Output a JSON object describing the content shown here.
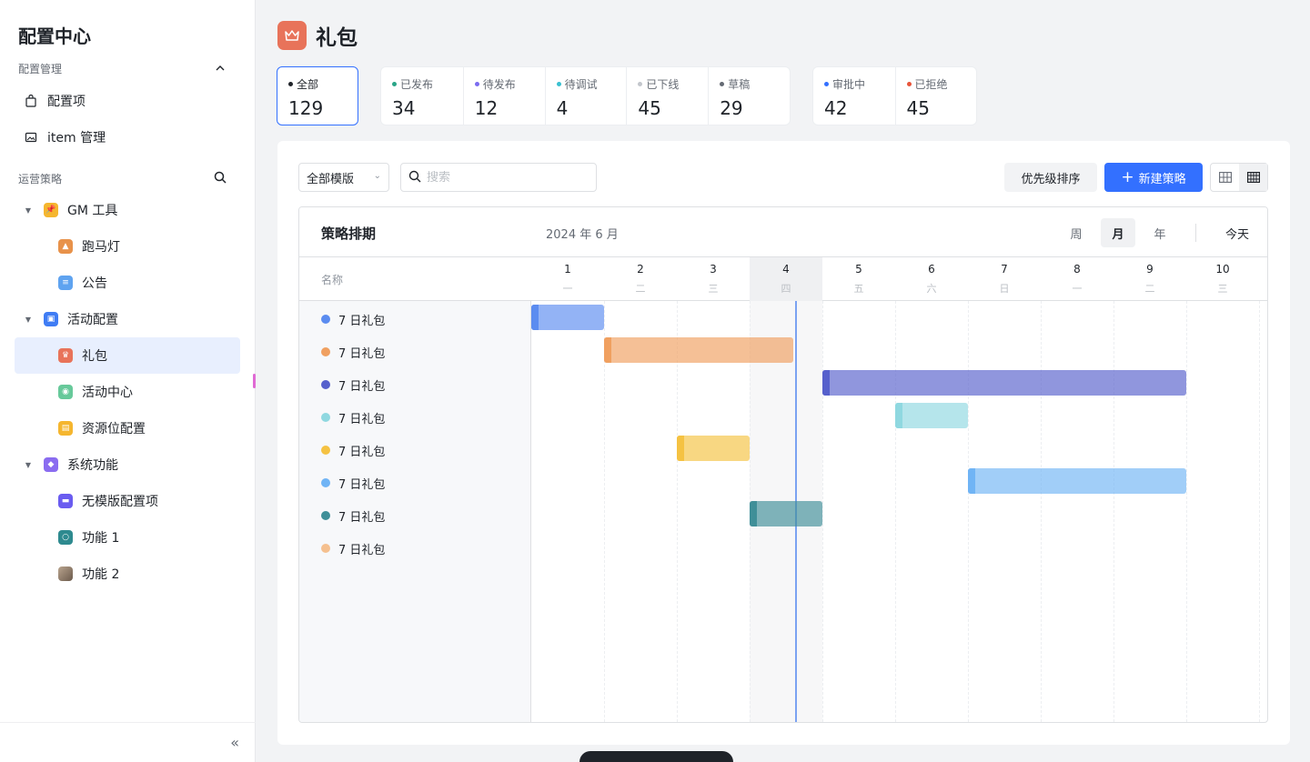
{
  "sidebar": {
    "title": "配置中心",
    "section_config": "配置管理",
    "config_items": [
      {
        "label": "配置项",
        "icon": "shopping-bag-icon"
      },
      {
        "label": "item 管理",
        "icon": "image-icon"
      }
    ],
    "section_ops": "运营策略",
    "tree": [
      {
        "label": "GM 工具",
        "icon": "pin-icon",
        "color": "#f5b62f",
        "children": [
          {
            "label": "跑马灯",
            "icon": "lamp-icon",
            "color": "#e8924a"
          },
          {
            "label": "公告",
            "icon": "message-icon",
            "color": "#5fa3f0"
          }
        ]
      },
      {
        "label": "活动配置",
        "icon": "gift-box-icon",
        "color": "#3f7cf4",
        "children": [
          {
            "label": "礼包",
            "icon": "crown-icon",
            "color": "#e8735a"
          },
          {
            "label": "活动中心",
            "icon": "shield-icon",
            "color": "#67c99a"
          },
          {
            "label": "资源位配置",
            "icon": "folder-icon",
            "color": "#f5b62f"
          }
        ]
      },
      {
        "label": "系统功能",
        "icon": "diamond-icon",
        "color": "#8a6cf0",
        "children": [
          {
            "label": "无模版配置项",
            "icon": "gamepad-icon",
            "color": "#6a5cf0"
          },
          {
            "label": "功能 1",
            "icon": "timer-icon",
            "color": "#2e8a8f"
          },
          {
            "label": "功能 2",
            "icon": "avatar-photo-icon",
            "color": "#8c7a6a"
          }
        ]
      }
    ],
    "collapse_glyph": "«"
  },
  "header": {
    "title": "礼包"
  },
  "stats": {
    "all": {
      "label": "全部",
      "value": "129",
      "color": "#1f2329"
    },
    "status": [
      {
        "label": "已发布",
        "value": "34",
        "color": "#2aa587"
      },
      {
        "label": "待发布",
        "value": "12",
        "color": "#7b6cf0"
      },
      {
        "label": "待调试",
        "value": "4",
        "color": "#38c0d0"
      },
      {
        "label": "已下线",
        "value": "45",
        "color": "#c3c6cc"
      },
      {
        "label": "草稿",
        "value": "29",
        "color": "#646a73"
      }
    ],
    "review": [
      {
        "label": "审批中",
        "value": "42",
        "color": "#3370ff"
      },
      {
        "label": "已拒绝",
        "value": "45",
        "color": "#e8543a"
      }
    ]
  },
  "toolbar": {
    "template_select": "全部模版",
    "search_placeholder": "搜索",
    "sort_label": "优先级排序",
    "new_label": "新建策略"
  },
  "gantt": {
    "title": "策略排期",
    "month": "2024 年 6 月",
    "name_header": "名称",
    "scales": [
      "周",
      "月",
      "年"
    ],
    "active_scale": "月",
    "today_label": "今天",
    "days": [
      {
        "n": "1",
        "w": "一"
      },
      {
        "n": "2",
        "w": "二"
      },
      {
        "n": "3",
        "w": "三"
      },
      {
        "n": "4",
        "w": "四"
      },
      {
        "n": "5",
        "w": "五"
      },
      {
        "n": "6",
        "w": "六"
      },
      {
        "n": "7",
        "w": "日"
      },
      {
        "n": "8",
        "w": "一"
      },
      {
        "n": "9",
        "w": "二"
      },
      {
        "n": "10",
        "w": "三"
      }
    ],
    "today_day": "4",
    "rows": [
      {
        "name": "7 日礼包",
        "color": "#5b8cf0",
        "start": 1,
        "end": 2
      },
      {
        "name": "7 日礼包",
        "color": "#f0a060",
        "start": 2,
        "end": 4.6
      },
      {
        "name": "7 日礼包",
        "color": "#5660cc",
        "start": 5,
        "end": 10
      },
      {
        "name": "7 日礼包",
        "color": "#8fd8e0",
        "start": 6,
        "end": 7
      },
      {
        "name": "7 日礼包",
        "color": "#f5c242",
        "start": 3,
        "end": 4
      },
      {
        "name": "7 日礼包",
        "color": "#70b4f5",
        "start": 7,
        "end": 10
      },
      {
        "name": "7 日礼包",
        "color": "#3f8f98",
        "start": 4,
        "end": 5
      },
      {
        "name": "7 日礼包",
        "color": "#f5c08f",
        "start": null,
        "end": null
      }
    ]
  }
}
